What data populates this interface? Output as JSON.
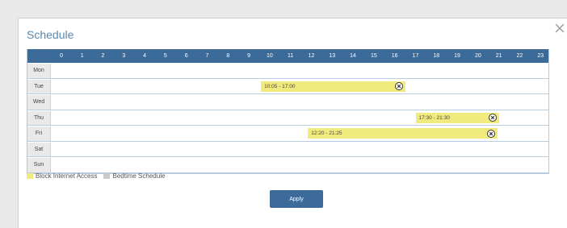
{
  "dialog": {
    "title": "Schedule",
    "close_icon": "close-icon"
  },
  "schedule": {
    "hours": [
      "0",
      "1",
      "2",
      "3",
      "4",
      "5",
      "6",
      "7",
      "8",
      "9",
      "10",
      "11",
      "12",
      "13",
      "14",
      "15",
      "16",
      "17",
      "18",
      "19",
      "20",
      "21",
      "22",
      "23"
    ],
    "days": [
      {
        "label": "Mon",
        "blocks": []
      },
      {
        "label": "Tue",
        "blocks": [
          {
            "text": "10:05 - 17:00",
            "start_hour": 10.0833,
            "end_hour": 17.0
          }
        ]
      },
      {
        "label": "Wed",
        "blocks": []
      },
      {
        "label": "Thu",
        "blocks": [
          {
            "text": "17:30 - 21:30",
            "start_hour": 17.5,
            "end_hour": 21.5
          }
        ]
      },
      {
        "label": "Fri",
        "blocks": [
          {
            "text": "12:20 - 21:25",
            "start_hour": 12.3333,
            "end_hour": 21.4167
          }
        ]
      },
      {
        "label": "Sat",
        "blocks": []
      },
      {
        "label": "Sun",
        "blocks": []
      }
    ],
    "remove_icon": "remove-circle-icon"
  },
  "legend": {
    "block_label": "Block Internet Access",
    "block_color": "#f1ea7c",
    "bedtime_label": "Bedtime Schedule",
    "bedtime_color": "#c9c9c9"
  },
  "actions": {
    "apply_label": "Apply"
  }
}
